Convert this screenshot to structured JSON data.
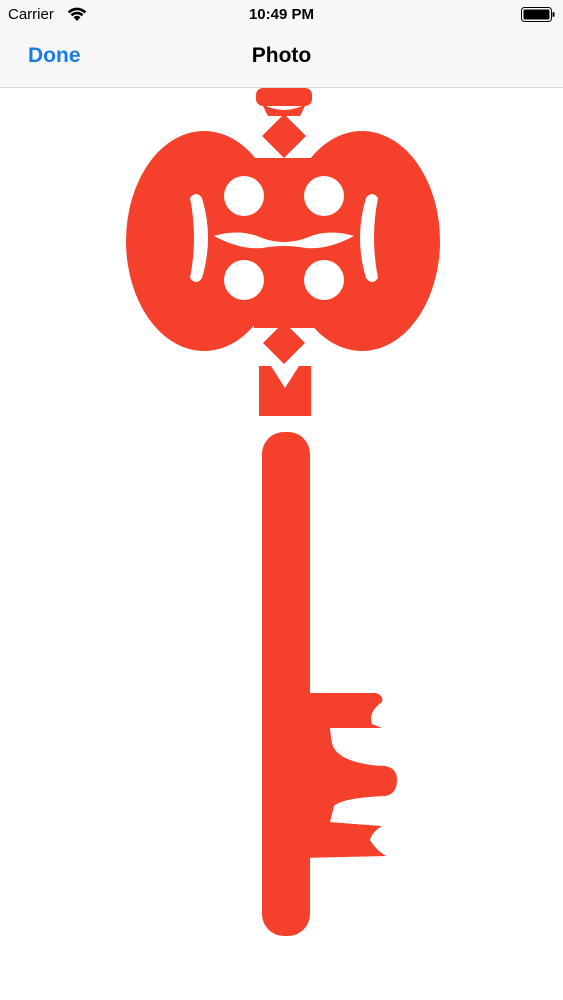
{
  "status_bar": {
    "carrier": "Carrier",
    "time": "10:49 PM",
    "wifi_icon": "wifi-icon",
    "battery_icon": "battery-icon"
  },
  "nav": {
    "done_label": "Done",
    "title": "Photo"
  },
  "photo": {
    "subject_icon": "key-icon",
    "color": "#f5412b"
  },
  "colors": {
    "accent": "#1a7de3",
    "bar_background": "#f7f7f7"
  }
}
